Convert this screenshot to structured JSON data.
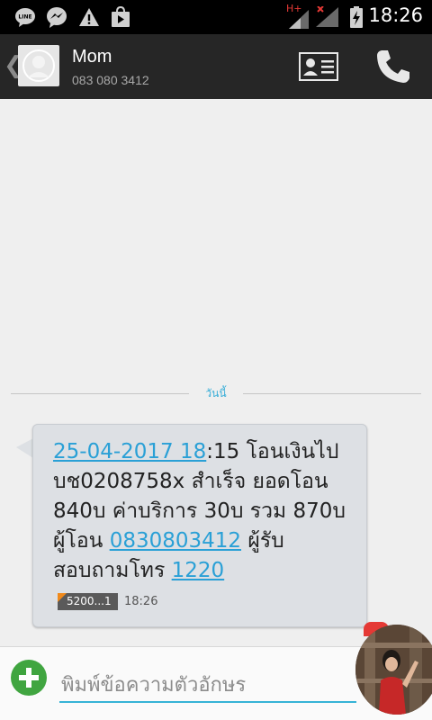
{
  "status_bar": {
    "time": "18:26",
    "network_type": "H+",
    "icons": [
      "line-app-icon",
      "messenger-icon",
      "warning-icon",
      "store-icon",
      "signal-icon",
      "battery-charging-icon"
    ]
  },
  "header": {
    "contact_name": "Mom",
    "contact_number": "083 080 3412",
    "icons": [
      "back-chevron-icon",
      "contact-card-icon",
      "phone-icon"
    ]
  },
  "conversation": {
    "date_separator": "วันนี้",
    "message": {
      "segments": [
        {
          "text": "25-04-2017 18",
          "link": true
        },
        {
          "text": ":15 โอนเงินไป บช0208758x สำเร็จ ยอดโอน 840บ ค่าบริการ 30บ รวม 870บ ผู้โอน ",
          "link": false
        },
        {
          "text": "0830803412",
          "link": true
        },
        {
          "text": " ผู้รับ  สอบถามโทร ",
          "link": false
        },
        {
          "text": "1220",
          "link": true
        }
      ],
      "sim_label": "5200...1",
      "time": "18:26"
    }
  },
  "compose": {
    "placeholder": "พิมพ์ข้อความตัวอักษร"
  },
  "colors": {
    "accent": "#2aa0d6",
    "bubble": "#dde0e4",
    "header": "#262626",
    "attach_button": "#40a540"
  }
}
